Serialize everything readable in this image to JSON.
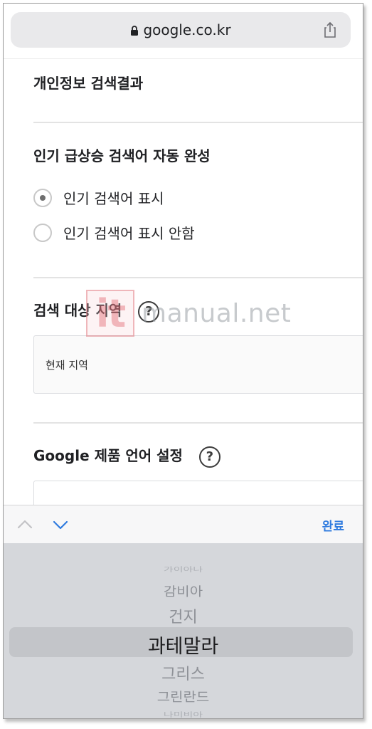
{
  "browser": {
    "url": "google.co.kr",
    "lock_icon": "lock-icon",
    "share_icon": "share-icon"
  },
  "settings": {
    "private_results_title": "개인정보 검색결과",
    "autocomplete_title": "인기 급상승 검색어 자동 완성",
    "radio_options": [
      {
        "label": "인기 검색어 표시",
        "checked": true
      },
      {
        "label": "인기 검색어 표시 안함",
        "checked": false
      }
    ],
    "region_title": "검색 대상 지역",
    "region_value": "현재 지역",
    "language_title": "Google 제품 언어 설정",
    "help_icon": "?"
  },
  "watermark": {
    "logo_text": "it",
    "site": "manual.net"
  },
  "keyboard_bar": {
    "done_label": "완료"
  },
  "picker": {
    "items": [
      "가이아나",
      "감비아",
      "건지",
      "과테말라",
      "그리스",
      "그린란드",
      "나미비아"
    ],
    "selected": "과테말라"
  },
  "colors": {
    "accent": "#2f7bdf",
    "watermark_logo": "#e77983"
  }
}
